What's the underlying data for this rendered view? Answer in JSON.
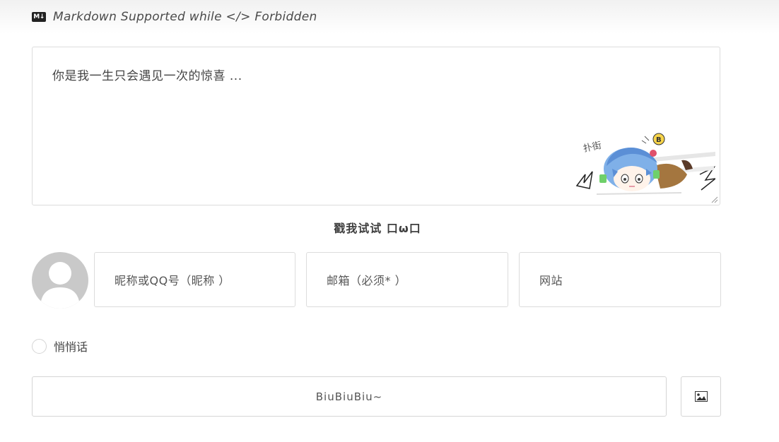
{
  "notice": {
    "icon": "markdown-icon",
    "icon_text": "M↓",
    "text": "Markdown Supported while </> Forbidden"
  },
  "editor": {
    "placeholder": "你是我一生只会遇见一次的惊喜 ...",
    "mascot_text": "扑街",
    "mascot_badge": "B"
  },
  "poke": {
    "label": "戳我试试 口ω口"
  },
  "form": {
    "avatar": "default-avatar",
    "nickname_placeholder": "昵称或QQ号（昵称 ）",
    "email_placeholder": "邮箱（必须* ）",
    "website_placeholder": "网站"
  },
  "private": {
    "label": "悄悄话"
  },
  "submit": {
    "label": "BiuBiuBiu~"
  },
  "image_upload": {
    "icon": "image-icon"
  }
}
